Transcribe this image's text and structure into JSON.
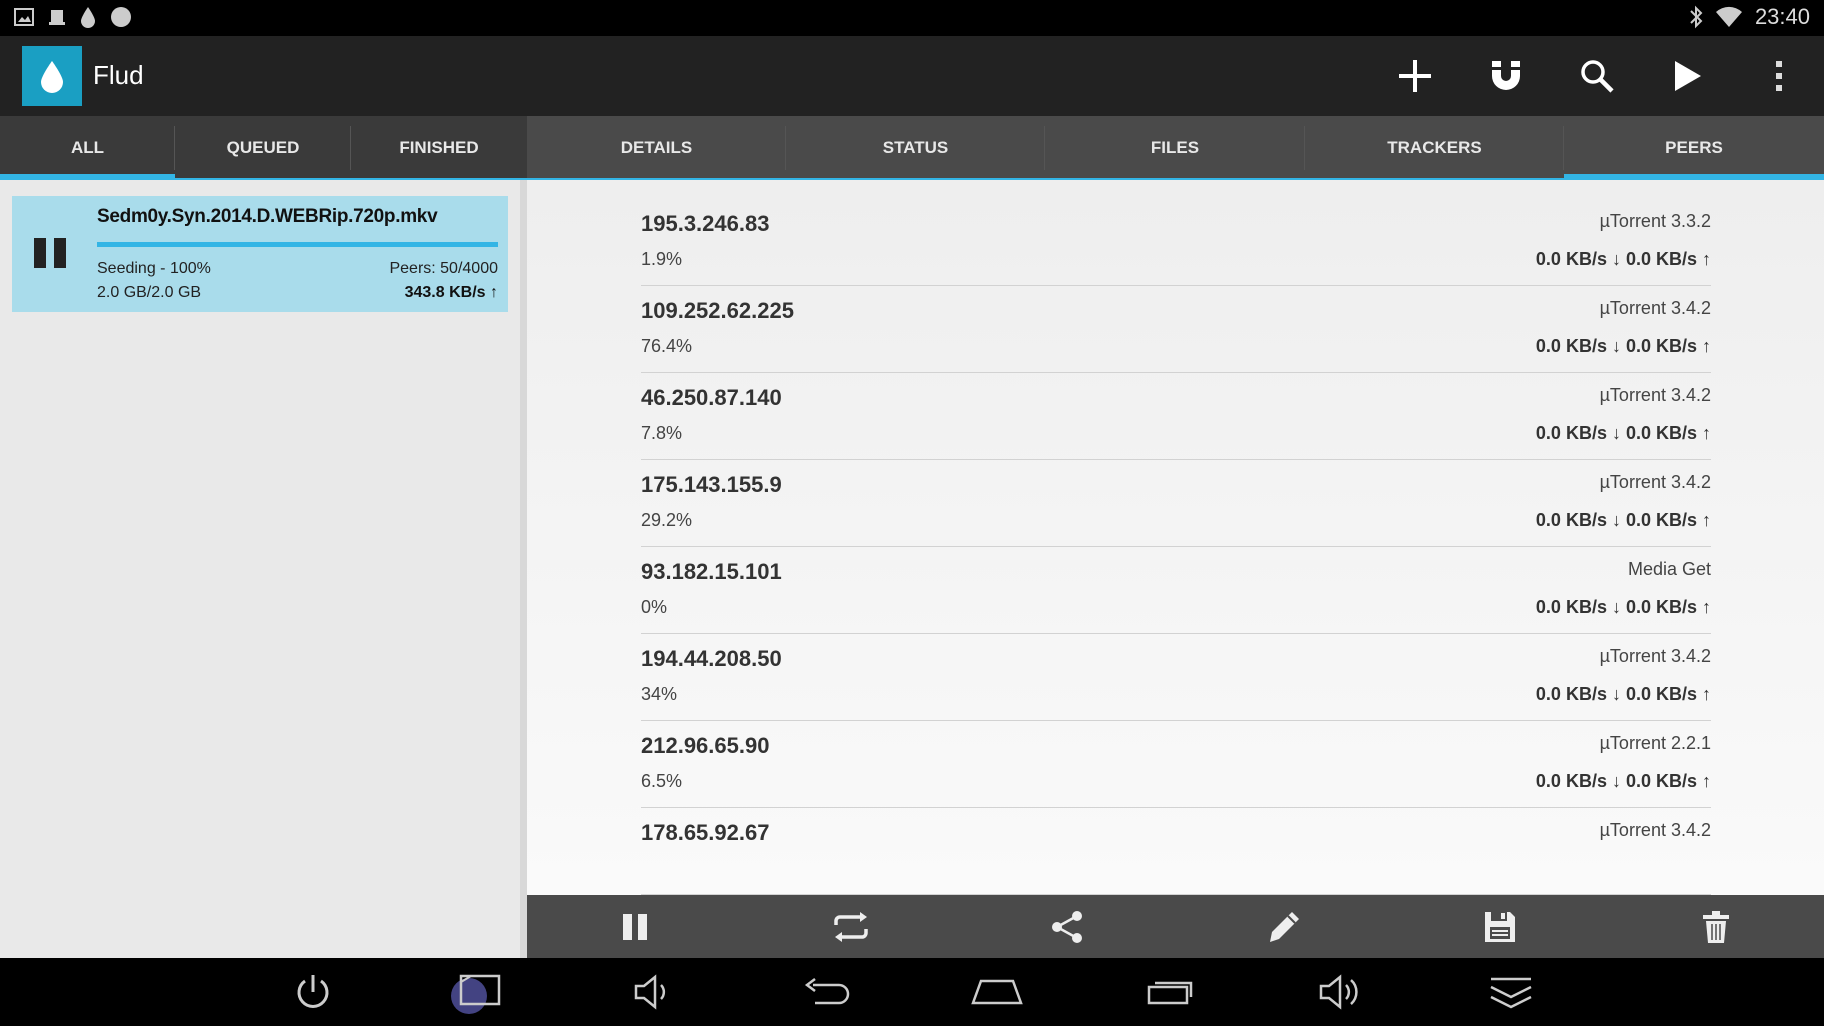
{
  "status_bar": {
    "time": "23:40",
    "left_icons": [
      "image-notification-icon",
      "screenshot-notification-icon",
      "flud-notification-icon",
      "circle-notification-icon"
    ],
    "right_icons": [
      "bluetooth-icon",
      "wifi-icon"
    ]
  },
  "app": {
    "title": "Flud",
    "accent": "#33b5e5",
    "logo_color": "#1a9fc3"
  },
  "actions": [
    "add-icon",
    "magnet-icon",
    "search-icon",
    "play-icon",
    "overflow-menu-icon"
  ],
  "tabs": {
    "left": [
      {
        "label": "ALL",
        "selected": true
      },
      {
        "label": "QUEUED",
        "selected": false
      },
      {
        "label": "FINISHED",
        "selected": false
      }
    ],
    "right": [
      {
        "label": "DETAILS",
        "selected": false
      },
      {
        "label": "STATUS",
        "selected": false
      },
      {
        "label": "FILES",
        "selected": false
      },
      {
        "label": "TRACKERS",
        "selected": false
      },
      {
        "label": "PEERS",
        "selected": true
      }
    ]
  },
  "torrent": {
    "name": "Sedm0y.Syn.2014.D.WEBRip.720p.mkv",
    "status": "Seeding - 100%",
    "progress": 1.0,
    "size": "2.0 GB/2.0 GB",
    "peers": "Peers: 50/4000",
    "speed": "343.8 KB/s ↑"
  },
  "peers": [
    {
      "ip": "195.3.246.83",
      "percent": "1.9%",
      "client": "µTorrent 3.3.2",
      "speed": "0.0 KB/s ↓ 0.0 KB/s ↑"
    },
    {
      "ip": "109.252.62.225",
      "percent": "76.4%",
      "client": "µTorrent 3.4.2",
      "speed": "0.0 KB/s ↓ 0.0 KB/s ↑"
    },
    {
      "ip": "46.250.87.140",
      "percent": "7.8%",
      "client": "µTorrent 3.4.2",
      "speed": "0.0 KB/s ↓ 0.0 KB/s ↑"
    },
    {
      "ip": "175.143.155.9",
      "percent": "29.2%",
      "client": "µTorrent 3.4.2",
      "speed": "0.0 KB/s ↓ 0.0 KB/s ↑"
    },
    {
      "ip": "93.182.15.101",
      "percent": "0%",
      "client": "Media Get",
      "speed": "0.0 KB/s ↓ 0.0 KB/s ↑"
    },
    {
      "ip": "194.44.208.50",
      "percent": "34%",
      "client": "µTorrent 3.4.2",
      "speed": "0.0 KB/s ↓ 0.0 KB/s ↑"
    },
    {
      "ip": "212.96.65.90",
      "percent": "6.5%",
      "client": "µTorrent 2.2.1",
      "speed": "0.0 KB/s ↓ 0.0 KB/s ↑"
    },
    {
      "ip": "178.65.92.67",
      "percent": "",
      "client": "µTorrent 3.4.2",
      "speed": ""
    }
  ],
  "toolbar": [
    "pause-icon",
    "recheck-icon",
    "share-icon",
    "edit-icon",
    "save-icon",
    "delete-icon"
  ],
  "nav": [
    "power-icon",
    "screenshot-icon",
    "volume-down-icon",
    "back-icon",
    "home-icon",
    "recent-apps-icon",
    "volume-up-icon",
    "collapse-icon"
  ]
}
